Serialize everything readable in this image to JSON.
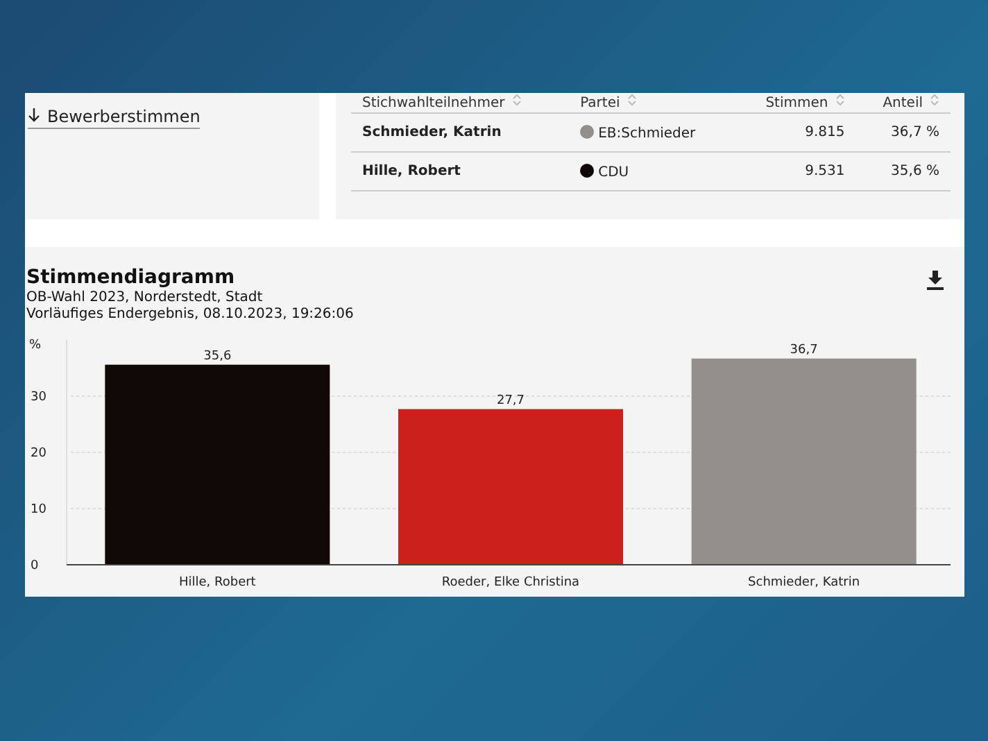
{
  "sidebar": {
    "link": "Bewerberstimmen"
  },
  "table": {
    "columns": [
      "Stichwahlteilnehmer",
      "Partei",
      "Stimmen",
      "Anteil"
    ],
    "rows": [
      {
        "name": "Schmieder, Katrin",
        "party": "EB:Schmieder",
        "color": "#938f8a",
        "votes": "9.815",
        "share": "36,7 %"
      },
      {
        "name": "Hille, Robert",
        "party": "CDU",
        "color": "#100805",
        "votes": "9.531",
        "share": "35,6 %"
      }
    ]
  },
  "chart": {
    "title": "Stimmendiagramm",
    "subtitle": "OB-Wahl 2023, Norderstedt, Stadt",
    "status": "Vorläufiges Endergebnis, 08.10.2023, 19:26:06",
    "chart_data": {
      "type": "bar",
      "ylabel": "%",
      "categories": [
        "Hille, Robert",
        "Roeder, Elke Christina",
        "Schmieder, Katrin"
      ],
      "series": [
        {
          "colors": [
            "#100805",
            "#cc201c",
            "#938f8a"
          ],
          "values": [
            35.6,
            27.7,
            36.7
          ]
        }
      ],
      "ylim": [
        0,
        40
      ],
      "yticks": [
        0,
        10,
        20,
        30
      ],
      "grid": true,
      "value_labels": [
        "35,6",
        "27,7",
        "36,7"
      ]
    }
  }
}
